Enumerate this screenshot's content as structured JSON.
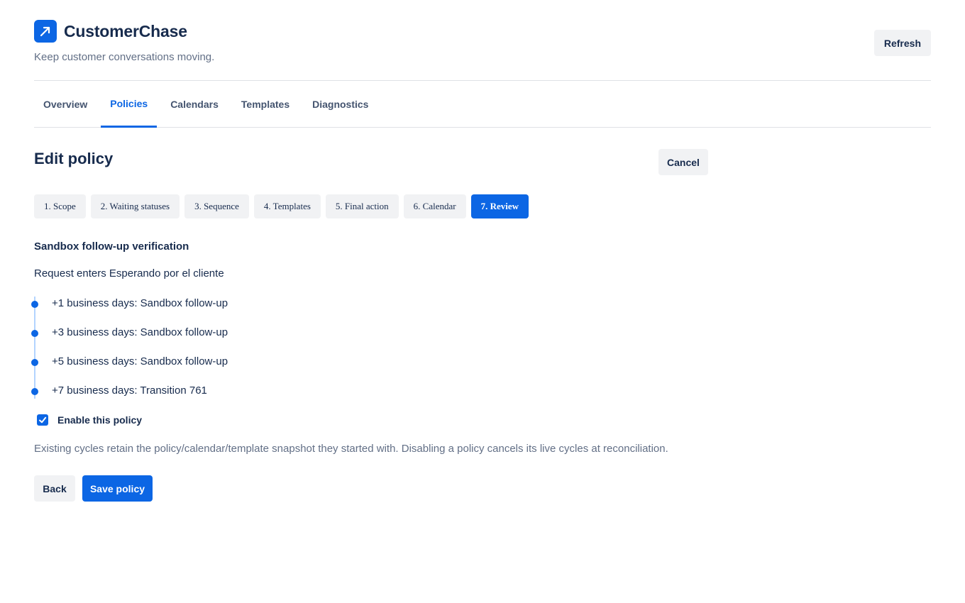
{
  "app": {
    "name": "CustomerChase",
    "tagline": "Keep customer conversations moving.",
    "logo_icon": "arrow-up-right-icon",
    "accent_color": "#0c66e4"
  },
  "header": {
    "refresh_label": "Refresh"
  },
  "nav": {
    "tabs": [
      {
        "label": "Overview",
        "active": false
      },
      {
        "label": "Policies",
        "active": true
      },
      {
        "label": "Calendars",
        "active": false
      },
      {
        "label": "Templates",
        "active": false
      },
      {
        "label": "Diagnostics",
        "active": false
      }
    ]
  },
  "page": {
    "title": "Edit policy",
    "cancel_label": "Cancel"
  },
  "wizard": {
    "steps": [
      {
        "label": "1. Scope",
        "active": false
      },
      {
        "label": "2. Waiting statuses",
        "active": false
      },
      {
        "label": "3. Sequence",
        "active": false
      },
      {
        "label": "4. Templates",
        "active": false
      },
      {
        "label": "5. Final action",
        "active": false
      },
      {
        "label": "6. Calendar",
        "active": false
      },
      {
        "label": "7. Review",
        "active": true
      }
    ]
  },
  "review": {
    "policy_name": "Sandbox follow-up verification",
    "trigger": "Request enters Esperando por el cliente",
    "timeline": [
      "+1 business days: Sandbox follow-up",
      "+3 business days: Sandbox follow-up",
      "+5 business days: Sandbox follow-up",
      "+7 business days: Transition 761"
    ],
    "enable_label": "Enable this policy",
    "enabled": true,
    "note": "Existing cycles retain the policy/calendar/template snapshot they started with. Disabling a policy cancels its live cycles at reconciliation."
  },
  "actions": {
    "back_label": "Back",
    "save_label": "Save policy"
  }
}
